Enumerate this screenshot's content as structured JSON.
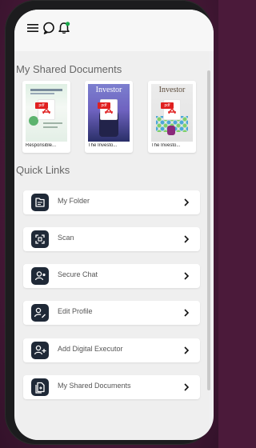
{
  "header": {
    "menu_icon": "menu-icon",
    "chat_icon": "chat-icon",
    "bell_icon": "bell-icon"
  },
  "shared_documents": {
    "title": "My Shared Documents",
    "items": [
      {
        "caption": "Responsible...",
        "pdf_label": "pdf"
      },
      {
        "caption": "The Investo...",
        "pdf_label": "pdf",
        "cover_masthead": "Investor"
      },
      {
        "caption": "The Investo...",
        "pdf_label": "pdf",
        "cover_masthead": "Investor"
      }
    ]
  },
  "quick_links": {
    "title": "Quick Links",
    "items": [
      {
        "label": "My Folder",
        "icon": "folder-icon"
      },
      {
        "label": "Scan",
        "icon": "scan-icon"
      },
      {
        "label": "Secure Chat",
        "icon": "secure-chat-icon"
      },
      {
        "label": "Edit Profile",
        "icon": "edit-profile-icon"
      },
      {
        "label": "Add Digital Executor",
        "icon": "add-executor-icon"
      },
      {
        "label": "My Shared Documents",
        "icon": "shared-documents-icon"
      }
    ]
  },
  "colors": {
    "accent": "#1f2937",
    "background": "#efefef",
    "notification": "#19a84a",
    "pdf_red": "#e02020"
  }
}
